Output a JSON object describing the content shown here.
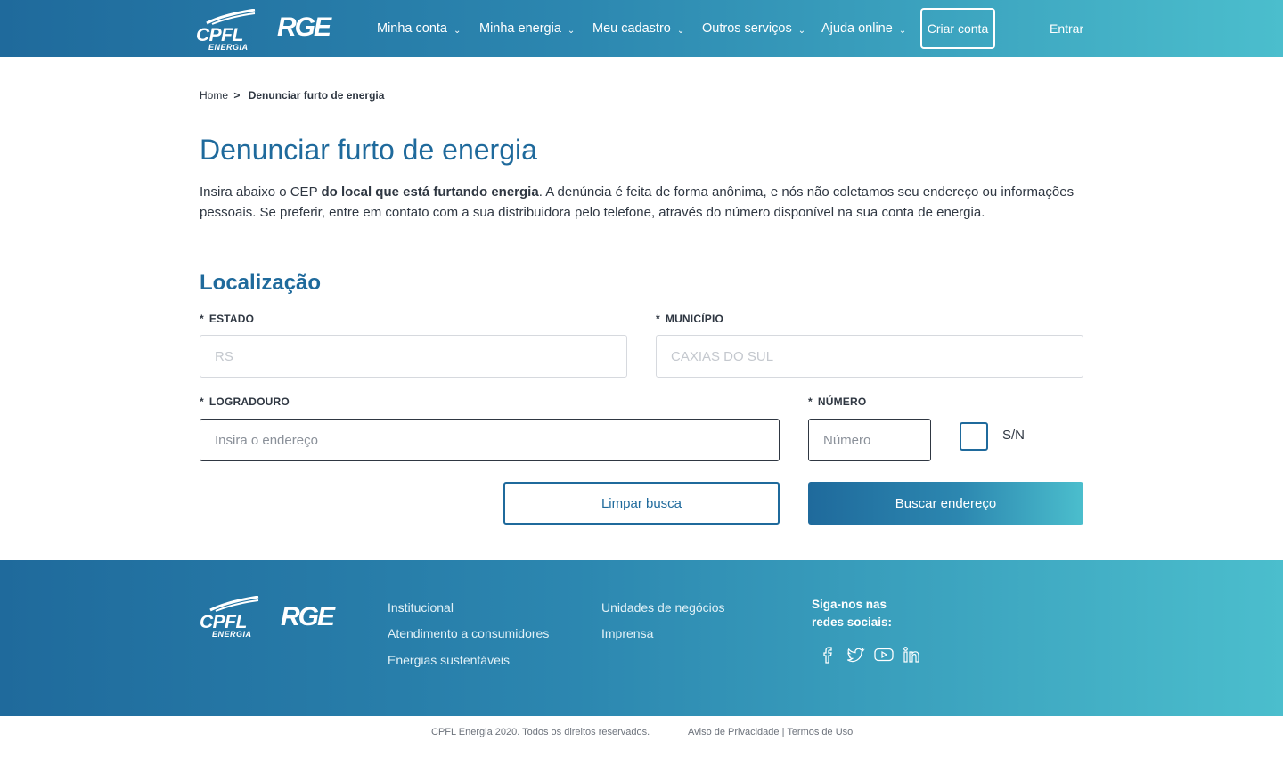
{
  "header": {
    "logo_cpfl": "CPFL",
    "logo_cpfl_sub": "ENERGIA",
    "logo_rge": "RGE",
    "nav": [
      {
        "label": "Minha conta"
      },
      {
        "label": "Minha energia"
      },
      {
        "label": "Meu cadastro"
      },
      {
        "label": "Outros serviços"
      },
      {
        "label": "Ajuda online"
      }
    ],
    "criar_conta": "Criar conta",
    "entrar": "Entrar"
  },
  "breadcrumb": {
    "home": "Home",
    "separator": ">",
    "current": "Denunciar furto de energia"
  },
  "page": {
    "title": "Denunciar furto de energia",
    "intro_prefix": "Insira abaixo o CEP ",
    "intro_bold": "do local que está furtando energia",
    "intro_suffix": ". A denúncia é feita de forma anônima, e nós não coletamos seu endereço ou informações pessoais. Se preferir, entre em contato com a sua distribuidora pelo telefone, através do número disponível na sua conta de energia."
  },
  "form": {
    "section_title": "Localização",
    "required_mark": "*",
    "estado": {
      "label": "ESTADO",
      "placeholder": "RS"
    },
    "municipio": {
      "label": "MUNICÍPIO",
      "placeholder": "CAXIAS DO SUL"
    },
    "logradouro": {
      "label": "LOGRADOURO",
      "placeholder": "Insira o endereço"
    },
    "numero": {
      "label": "NÚMERO",
      "placeholder": "Número"
    },
    "sn_label": "S/N",
    "limpar_button": "Limpar busca",
    "buscar_button": "Buscar endereço"
  },
  "footer": {
    "logo_cpfl": "CPFL",
    "logo_cpfl_sub": "ENERGIA",
    "logo_rge": "RGE",
    "links_col1": [
      "Institucional",
      "Atendimento a consumidores",
      "Energias sustentáveis"
    ],
    "links_col2": [
      "Unidades de negócios",
      "Imprensa"
    ],
    "social_title": "Siga-nos nas redes sociais:",
    "social_icons": [
      "facebook-icon",
      "twitter-icon",
      "youtube-icon",
      "linkedin-icon"
    ],
    "copyright": "CPFL Energia 2020. Todos os direitos reservados.",
    "privacy": "Aviso de Privacidade",
    "legal_sep": "|",
    "terms": "Termos de Uso"
  },
  "colors": {
    "primary": "#1f6a9c",
    "gradient_end": "#4bbecd",
    "text": "#2f3742"
  }
}
